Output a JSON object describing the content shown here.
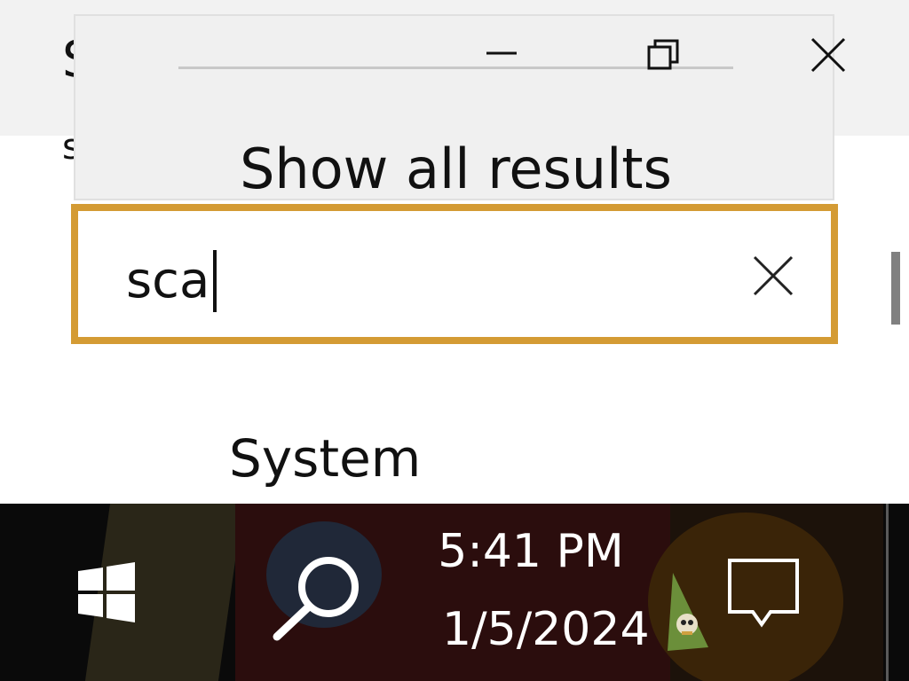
{
  "background_window": {
    "title_partial": "S",
    "subtitle_partial": "s",
    "section_heading": "System"
  },
  "flyout": {
    "minimize_icon": "minimize-icon",
    "restore_icon": "restore-icon",
    "close_icon": "close-icon",
    "show_all_label": "Show all results"
  },
  "search": {
    "value": "sca",
    "clear_icon": "clear-icon",
    "accent_color": "#d49b34"
  },
  "taskbar": {
    "start_icon": "windows-start-icon",
    "search_icon": "search-icon",
    "time": "5:41 PM",
    "date": "1/5/2024",
    "tray_icon": "tray-app-icon",
    "notification_icon": "action-center-icon"
  }
}
